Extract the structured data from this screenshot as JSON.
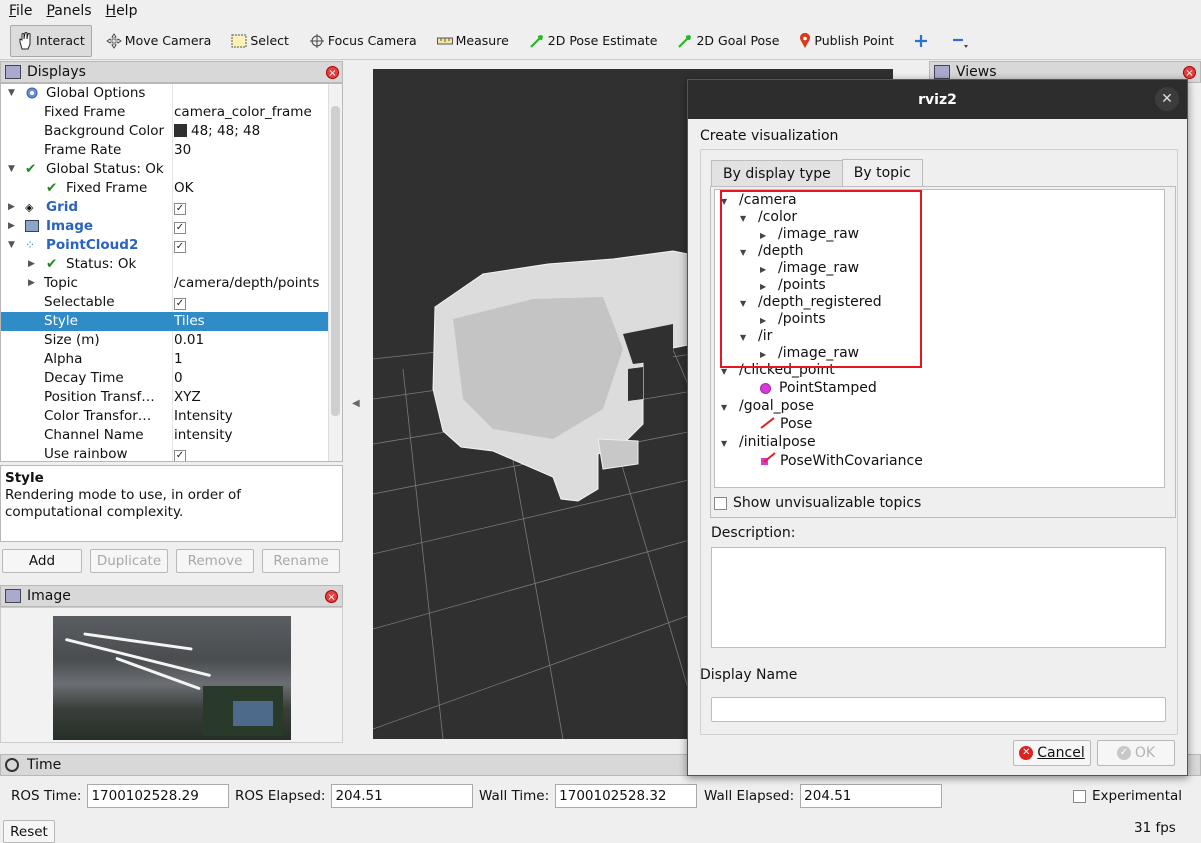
{
  "menu": {
    "file": "File",
    "panels": "Panels",
    "help": "Help"
  },
  "toolbar": {
    "interact": "Interact",
    "move_camera": "Move Camera",
    "select": "Select",
    "focus_camera": "Focus Camera",
    "measure": "Measure",
    "pose_estimate": "2D Pose Estimate",
    "goal_pose": "2D Goal Pose",
    "publish_point": "Publish Point"
  },
  "displays": {
    "title": "Displays",
    "rows": {
      "global_options": "Global Options",
      "fixed_frame": "Fixed Frame",
      "fixed_frame_val": "camera_color_frame",
      "background_color": "Background Color",
      "background_color_val": "48; 48; 48",
      "frame_rate": "Frame Rate",
      "frame_rate_val": "30",
      "global_status": "Global Status: Ok",
      "gs_fixed_frame": "Fixed Frame",
      "gs_fixed_frame_val": "OK",
      "grid": "Grid",
      "image": "Image",
      "pointcloud": "PointCloud2",
      "status": "Status: Ok",
      "topic": "Topic",
      "topic_val": "/camera/depth/points",
      "selectable": "Selectable",
      "style": "Style",
      "style_val": "Tiles",
      "size": "Size (m)",
      "size_val": "0.01",
      "alpha": "Alpha",
      "alpha_val": "1",
      "decay": "Decay Time",
      "decay_val": "0",
      "position_transformer": "Position Transf…",
      "position_transformer_val": "XYZ",
      "color_transformer": "Color Transfor…",
      "color_transformer_val": "Intensity",
      "channel": "Channel Name",
      "channel_val": "intensity",
      "rainbow": "Use rainbow"
    },
    "background_swatch": "#303030"
  },
  "help": {
    "title": "Style",
    "text": "Rendering mode to use, in order of computational complexity."
  },
  "buttons": {
    "add": "Add",
    "duplicate": "Duplicate",
    "remove": "Remove",
    "rename": "Rename"
  },
  "image_panel": {
    "title": "Image"
  },
  "views_panel": {
    "title": "Views"
  },
  "time": {
    "title": "Time",
    "ros_time_label": "ROS Time:",
    "ros_time": "1700102528.29",
    "ros_elapsed_label": "ROS Elapsed:",
    "ros_elapsed": "204.51",
    "wall_time_label": "Wall Time:",
    "wall_time": "1700102528.32",
    "wall_elapsed_label": "Wall Elapsed:",
    "wall_elapsed": "204.51",
    "experimental": "Experimental",
    "reset": "Reset",
    "fps": "31 fps"
  },
  "dialog": {
    "title": "rviz2",
    "heading": "Create visualization",
    "tab_type": "By display type",
    "tab_topic": "By topic",
    "topics": {
      "camera": "/camera",
      "color": "/color",
      "color_raw": "/image_raw",
      "depth": "/depth",
      "depth_raw": "/image_raw",
      "depth_points": "/points",
      "depth_registered": "/depth_registered",
      "reg_points": "/points",
      "ir": "/ir",
      "ir_raw": "/image_raw",
      "clicked_point": "/clicked_point",
      "point_stamped": "PointStamped",
      "goal_pose": "/goal_pose",
      "pose": "Pose",
      "initialpose": "/initialpose",
      "pose_cov": "PoseWithCovariance"
    },
    "show_unvis": "Show unvisualizable topics",
    "description_label": "Description:",
    "display_name_label": "Display Name",
    "display_name_value": "",
    "cancel": "Cancel",
    "ok": "OK",
    "highlight_color": "#e8141e"
  }
}
